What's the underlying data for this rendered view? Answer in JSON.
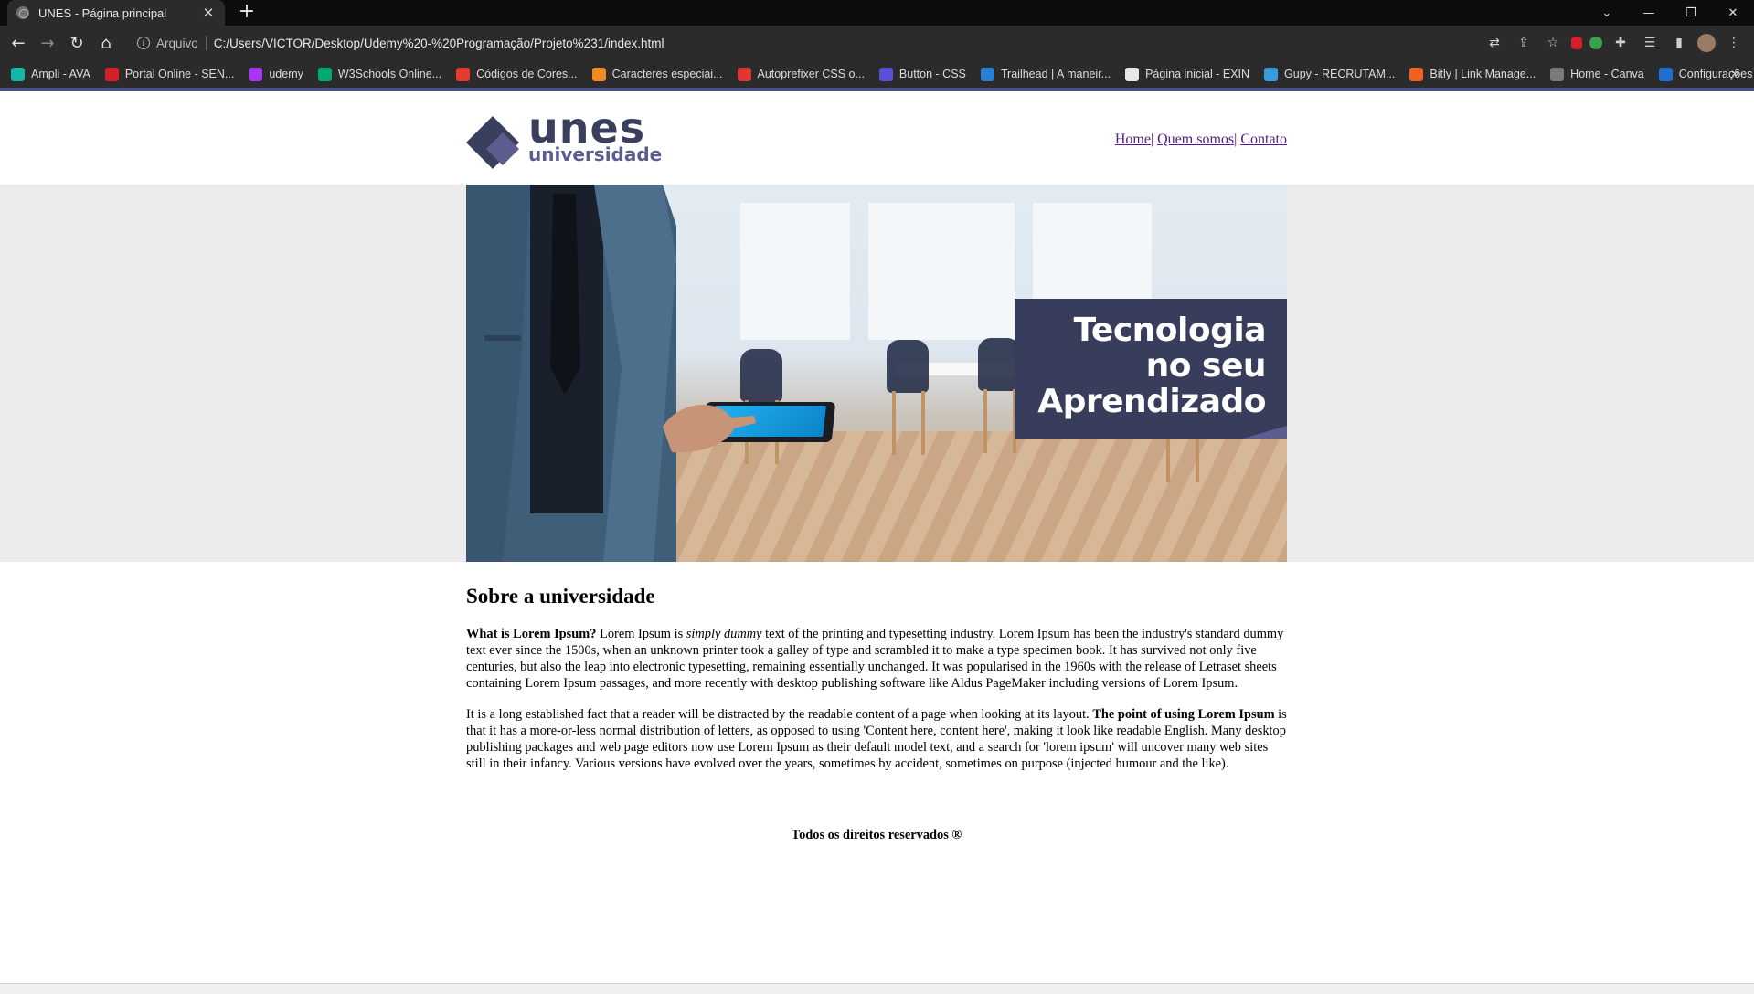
{
  "browser": {
    "tab_title": "UNES - Página principal",
    "site_info_label": "Arquivo",
    "url": "C:/Users/VICTOR/Desktop/Udemy%20-%20Programação/Projeto%231/index.html",
    "bookmarks": [
      {
        "label": "Ampli - AVA",
        "icon": "ampli-icon",
        "color": "#18b4a6"
      },
      {
        "label": "Portal Online - SEN...",
        "icon": "s-icon",
        "color": "#d3202a"
      },
      {
        "label": "udemy",
        "icon": "udemy-icon",
        "color": "#a435f0"
      },
      {
        "label": "W3Schools Online...",
        "icon": "w3-icon",
        "color": "#04aa6d"
      },
      {
        "label": "Códigos de Cores...",
        "icon": "color-codes-icon",
        "color": "#e33b2e"
      },
      {
        "label": "Caracteres especiai...",
        "icon": "chars-icon",
        "color": "#f08a24"
      },
      {
        "label": "Autoprefixer CSS o...",
        "icon": "autoprefixer-icon",
        "color": "#dd3735"
      },
      {
        "label": "Button - CSS",
        "icon": "ui-icon",
        "color": "#5a4fd6"
      },
      {
        "label": "Trailhead | A maneir...",
        "icon": "trailhead-icon",
        "color": "#2a7fd4"
      },
      {
        "label": "Página inicial - EXIN",
        "icon": "exin-icon",
        "color": "#e8e8e8"
      },
      {
        "label": "Gupy - RECRUTAM...",
        "icon": "gupy-icon",
        "color": "#3a9bdc"
      },
      {
        "label": "Bitly | Link Manage...",
        "icon": "bitly-icon",
        "color": "#ee6123"
      },
      {
        "label": "Home - Canva",
        "icon": "globe-icon",
        "color": "#7a7a7a"
      },
      {
        "label": "Configurações",
        "icon": "paypal-icon",
        "color": "#1f6fd1"
      }
    ]
  },
  "site": {
    "logo_word": "unes",
    "logo_sub": "universidade",
    "nav": {
      "home": "Home",
      "about": "Quem somos",
      "contact": "Contato",
      "divider": "|"
    },
    "hero_text": {
      "line1": "Tecnologia",
      "line2": "no seu",
      "line3": "Aprendizado"
    },
    "section_title": "Sobre a universidade",
    "p1": {
      "strong": "What is Lorem Ipsum?",
      "a": " Lorem Ipsum is ",
      "em": "simply dummy",
      "b": " text of the printing and typesetting industry. Lorem Ipsum has been the industry's standard dummy text ever since the 1500s, when an unknown printer took a galley of type and scrambled it to make a type specimen book. It has survived not only five centuries, but also the leap into electronic typesetting, remaining essentially unchanged. It was popularised in the 1960s with the release of Letraset sheets containing Lorem Ipsum passages, and more recently with desktop publishing software like Aldus PageMaker including versions of Lorem Ipsum."
    },
    "p2": {
      "a": "It is a long established fact that a reader will be distracted by the readable content of a page when looking at its layout. ",
      "strong": "The point of using Lorem Ipsum",
      "b": " is that it has a more-or-less normal distribution of letters, as opposed to using 'Content here, content here', making it look like readable English. Many desktop publishing packages and web page editors now use Lorem Ipsum as their default model text, and a search for 'lorem ipsum' will uncover many web sites still in their infancy. Various versions have evolved over the years, sometimes by accident, sometimes on purpose (injected humour and the like)."
    },
    "footer": "Todos os direitos reservados ®"
  },
  "colors": {
    "brand_dark": "#383d5c",
    "brand_light": "#5a5d8e",
    "link_visited": "#551a8b"
  }
}
